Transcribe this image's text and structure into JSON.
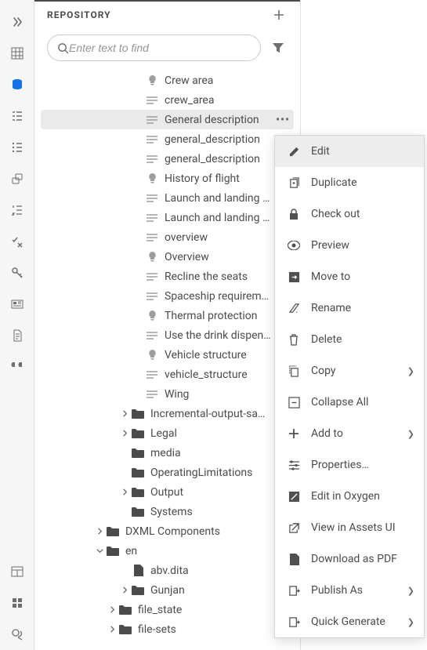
{
  "panel": {
    "title": "REPOSITORY"
  },
  "search": {
    "placeholder": "Enter text to find"
  },
  "tree_leaf": [
    {
      "icon": "bulb",
      "label": "Crew area"
    },
    {
      "icon": "para",
      "label": "crew_area"
    },
    {
      "icon": "para",
      "label": "General description",
      "selected": true
    },
    {
      "icon": "para",
      "label": "general_description"
    },
    {
      "icon": "para",
      "label": "general_description"
    },
    {
      "icon": "bulb",
      "label": "History of flight"
    },
    {
      "icon": "para",
      "label": "Launch and landing site"
    },
    {
      "icon": "para",
      "label": "Launch and landing site"
    },
    {
      "icon": "para",
      "label": "overview"
    },
    {
      "icon": "bulb",
      "label": "Overview"
    },
    {
      "icon": "para",
      "label": "Recline the seats"
    },
    {
      "icon": "para",
      "label": "Spaceship requirements"
    },
    {
      "icon": "bulb",
      "label": "Thermal protection"
    },
    {
      "icon": "para",
      "label": "Use the drink dispenser"
    },
    {
      "icon": "bulb",
      "label": "Vehicle structure"
    },
    {
      "icon": "para",
      "label": "vehicle_structure"
    },
    {
      "icon": "para",
      "label": "Wing"
    }
  ],
  "tree_folders_l1": [
    {
      "label": "Incremental-output-sample",
      "chevron": true
    },
    {
      "label": "Legal",
      "chevron": true
    },
    {
      "label": "media",
      "chevron": false
    },
    {
      "label": "OperatingLimitations",
      "chevron": false
    },
    {
      "label": "Output",
      "chevron": true
    },
    {
      "label": "Systems",
      "chevron": false
    }
  ],
  "tree_dxml": {
    "label": "DXML Components"
  },
  "tree_en": {
    "label": "en"
  },
  "tree_en_children": [
    {
      "icon": "file",
      "label": "abv.dita",
      "chevron": false
    },
    {
      "icon": "folder",
      "label": "Gunjan",
      "chevron": true
    },
    {
      "icon": "folder",
      "label": "file_state",
      "chevron": true
    },
    {
      "icon": "folder",
      "label": "file-sets",
      "chevron": true
    }
  ],
  "menu": [
    {
      "icon": "edit",
      "label": "Edit",
      "highlight": true
    },
    {
      "icon": "duplicate",
      "label": "Duplicate"
    },
    {
      "icon": "lock",
      "label": "Check out"
    },
    {
      "icon": "eye",
      "label": "Preview"
    },
    {
      "icon": "move",
      "label": "Move to"
    },
    {
      "icon": "rename",
      "label": "Rename"
    },
    {
      "icon": "trash",
      "label": "Delete"
    },
    {
      "icon": "copy",
      "label": "Copy",
      "sub": true
    },
    {
      "icon": "collapse",
      "label": "Collapse All"
    },
    {
      "icon": "plus",
      "label": "Add to",
      "sub": true
    },
    {
      "icon": "props",
      "label": "Properties…"
    },
    {
      "icon": "oxygen",
      "label": "Edit in Oxygen"
    },
    {
      "icon": "external",
      "label": "View in Assets UI"
    },
    {
      "icon": "pdf",
      "label": "Download as PDF"
    },
    {
      "icon": "publish",
      "label": "Publish As",
      "sub": true
    },
    {
      "icon": "generate",
      "label": "Quick Generate",
      "sub": true
    }
  ]
}
